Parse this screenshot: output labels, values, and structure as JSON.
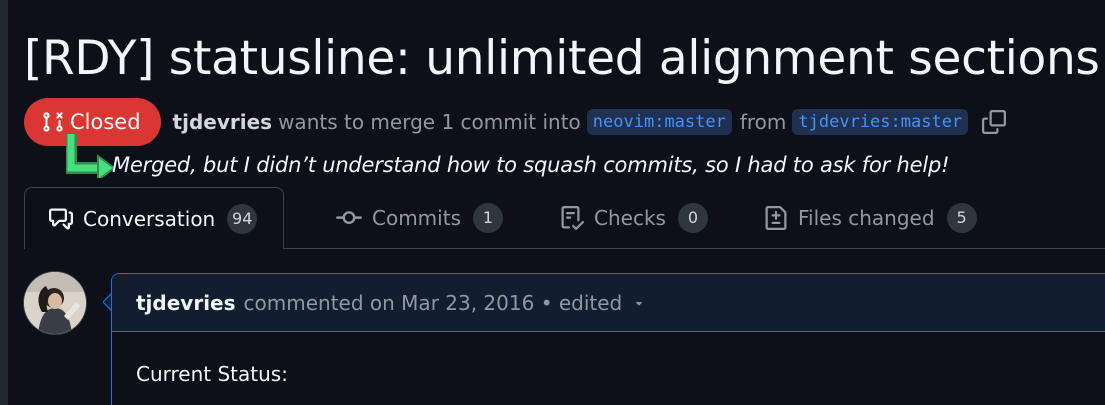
{
  "pr": {
    "title": "[RDY] statusline: unlimited alignment sections",
    "state": "Closed",
    "author": "tjdevries",
    "merge_text": "wants to merge 1 commit into",
    "base_branch": "neovim:master",
    "from_text": "from",
    "head_branch": "tjdevries:master"
  },
  "annotation": "Merged, but I didn’t understand how to squash commits, so I had to ask for help!",
  "tabs": [
    {
      "label": "Conversation",
      "count": "94",
      "icon": "comment-discussion-icon"
    },
    {
      "label": "Commits",
      "count": "1",
      "icon": "git-commit-icon"
    },
    {
      "label": "Checks",
      "count": "0",
      "icon": "checklist-icon"
    },
    {
      "label": "Files changed",
      "count": "5",
      "icon": "file-diff-icon"
    }
  ],
  "comment": {
    "author": "tjdevries",
    "meta": "commented on Mar 23, 2016 • edited",
    "body": "Current Status:"
  },
  "colors": {
    "background": "#0d1117",
    "closed_badge": "#da3633",
    "branch_text": "#4493f8",
    "annotation_arrow": "#3fb950",
    "comment_border": "#1f6feb"
  }
}
